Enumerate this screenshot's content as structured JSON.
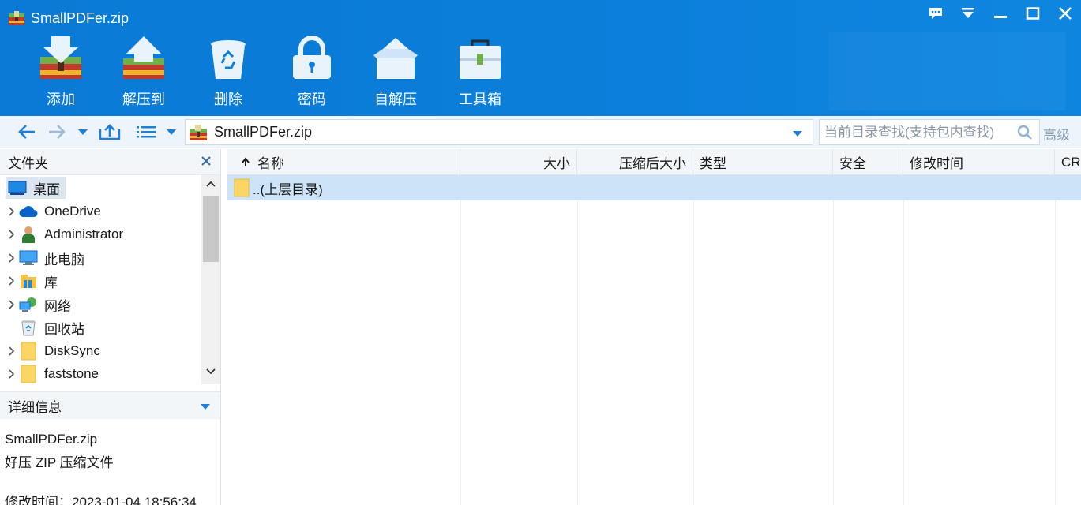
{
  "window": {
    "title": "SmallPDFer.zip"
  },
  "toolbar": {
    "items": [
      {
        "label": "添加",
        "icon": "add-archive-icon"
      },
      {
        "label": "解压到",
        "icon": "extract-to-icon"
      },
      {
        "label": "删除",
        "icon": "recycle-bin-icon"
      },
      {
        "label": "密码",
        "icon": "lock-icon"
      },
      {
        "label": "自解压",
        "icon": "self-extract-box-icon"
      },
      {
        "label": "工具箱",
        "icon": "toolbox-icon"
      }
    ]
  },
  "address": {
    "path": "SmallPDFer.zip",
    "search_placeholder": "当前目录查找(支持包内查找)",
    "advanced_label": "高级"
  },
  "folders_panel": {
    "header": "文件夹",
    "items": [
      {
        "label": "桌面",
        "icon": "desktop-icon",
        "expandable": false,
        "selected": true
      },
      {
        "label": "OneDrive",
        "icon": "cloud-icon",
        "expandable": true
      },
      {
        "label": "Administrator",
        "icon": "user-icon",
        "expandable": true
      },
      {
        "label": "此电脑",
        "icon": "computer-icon",
        "expandable": true
      },
      {
        "label": "库",
        "icon": "library-icon",
        "expandable": true
      },
      {
        "label": "网络",
        "icon": "network-icon",
        "expandable": true
      },
      {
        "label": "回收站",
        "icon": "recycle-bin-icon",
        "expandable": false
      },
      {
        "label": "DiskSync",
        "icon": "folder-icon",
        "expandable": true
      },
      {
        "label": "faststone",
        "icon": "folder-icon",
        "expandable": true
      }
    ]
  },
  "details_panel": {
    "header": "详细信息",
    "filename": "SmallPDFer.zip",
    "filetype": "好压 ZIP 压缩文件",
    "modified": "修改时间：2023-01-04 18:56:34"
  },
  "file_list": {
    "columns": [
      "名称",
      "大小",
      "压缩后大小",
      "类型",
      "安全",
      "修改时间",
      "CR"
    ],
    "rows": [
      {
        "name": "..(上层目录)"
      }
    ]
  },
  "colors": {
    "title_bar": "#0b7fdb",
    "selected_row": "#cde3f7",
    "panel_header": "#f3f6f9"
  }
}
